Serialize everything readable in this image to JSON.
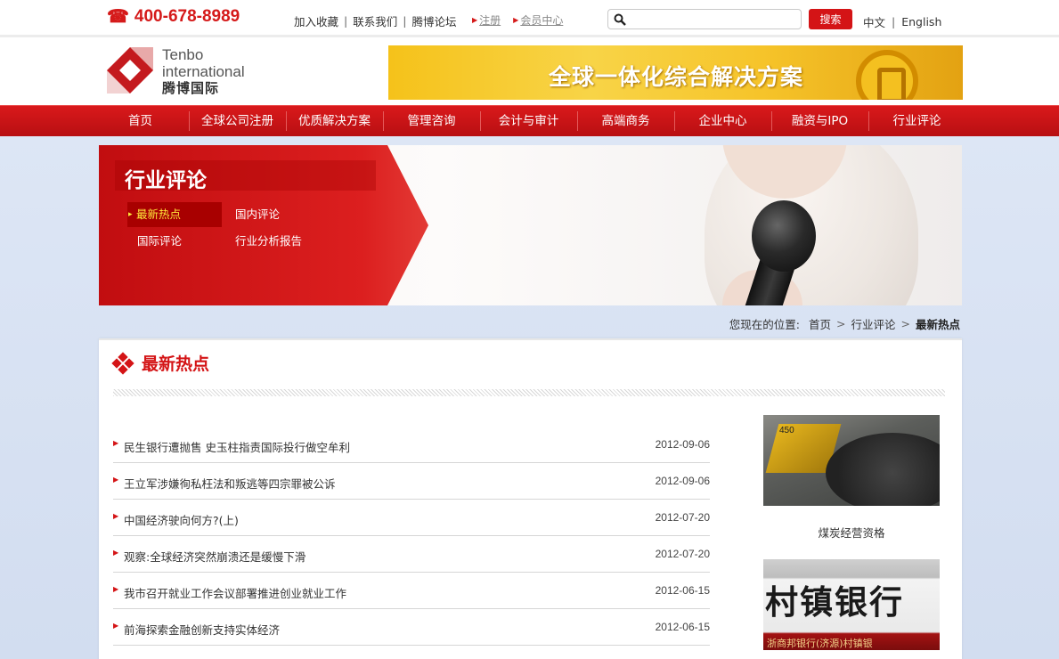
{
  "topbar": {
    "phone": "400-678-8989",
    "links": [
      "加入收藏",
      "联系我们",
      "腾博论坛"
    ],
    "register": "注册",
    "member_center": "会员中心",
    "search_placeholder": "",
    "search_button": "搜索",
    "lang_cn": "中文",
    "lang_en": "English"
  },
  "header": {
    "logo_en1": "Tenbo",
    "logo_en2": "international",
    "logo_cn": "腾博国际",
    "banner_text": "全球一体化综合解决方案"
  },
  "nav": [
    "首页",
    "全球公司注册",
    "优质解决方案",
    "管理咨询",
    "会计与审计",
    "高端商务",
    "企业中心",
    "融资与IPO",
    "行业评论"
  ],
  "hero": {
    "title": "行业评论",
    "submenu": [
      "最新热点",
      "国内评论",
      "国际评论",
      "行业分析报告"
    ]
  },
  "breadcrumb": {
    "label": "您现在的位置:",
    "items": [
      "首页",
      "行业评论"
    ],
    "current": "最新热点",
    "separator": ">"
  },
  "main": {
    "section_title": "最新热点",
    "news": [
      {
        "title": "民生银行遭抛售 史玉柱指责国际投行做空牟利",
        "date": "2012-09-06"
      },
      {
        "title": "王立军涉嫌徇私枉法和叛逃等四宗罪被公诉",
        "date": "2012-09-06"
      },
      {
        "title": "中国经济驶向何方?(上)",
        "date": "2012-07-20"
      },
      {
        "title": "观察:全球经济突然崩溃还是缓慢下滑",
        "date": "2012-07-20"
      },
      {
        "title": "我市召开就业工作会议部署推进创业就业工作",
        "date": "2012-06-15"
      },
      {
        "title": "前海探索金融创新支持实体经济",
        "date": "2012-06-15"
      }
    ],
    "side": {
      "coal_tag": "450",
      "coal_caption": "煤炭经营资格",
      "bank_text": "村镇银行",
      "bank_sub": "浙商邦银行(济源)村镇银"
    }
  },
  "colors": {
    "brand_red": "#d41416",
    "nav_red": "#c8141a",
    "active_yellow": "#ffe83a"
  }
}
